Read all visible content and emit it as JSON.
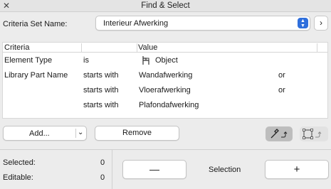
{
  "window": {
    "title": "Find & Select"
  },
  "criteria_set": {
    "label": "Criteria Set Name:",
    "value": "Interieur Afwerking"
  },
  "table": {
    "columns": [
      "Criteria",
      "Value"
    ],
    "rows": [
      {
        "criteria": "Element Type",
        "operator": "is",
        "value": "Object",
        "icon": "object-chair-icon",
        "logic": ""
      },
      {
        "criteria": "Library Part Name",
        "operator": "starts with",
        "value": "Wandafwerking",
        "logic": "or"
      },
      {
        "criteria": "",
        "operator": "starts with",
        "value": "Vloerafwerking",
        "logic": "or"
      },
      {
        "criteria": "",
        "operator": "starts with",
        "value": "Plafondafwerking",
        "logic": ""
      }
    ]
  },
  "buttons": {
    "add": "Add...",
    "remove": "Remove",
    "minus": "—",
    "plus": "+"
  },
  "stats": {
    "selected_label": "Selected:",
    "selected_value": "0",
    "editable_label": "Editable:",
    "editable_value": "0"
  },
  "selection_label": "Selection",
  "colors": {
    "accent": "#2f6fdc"
  }
}
